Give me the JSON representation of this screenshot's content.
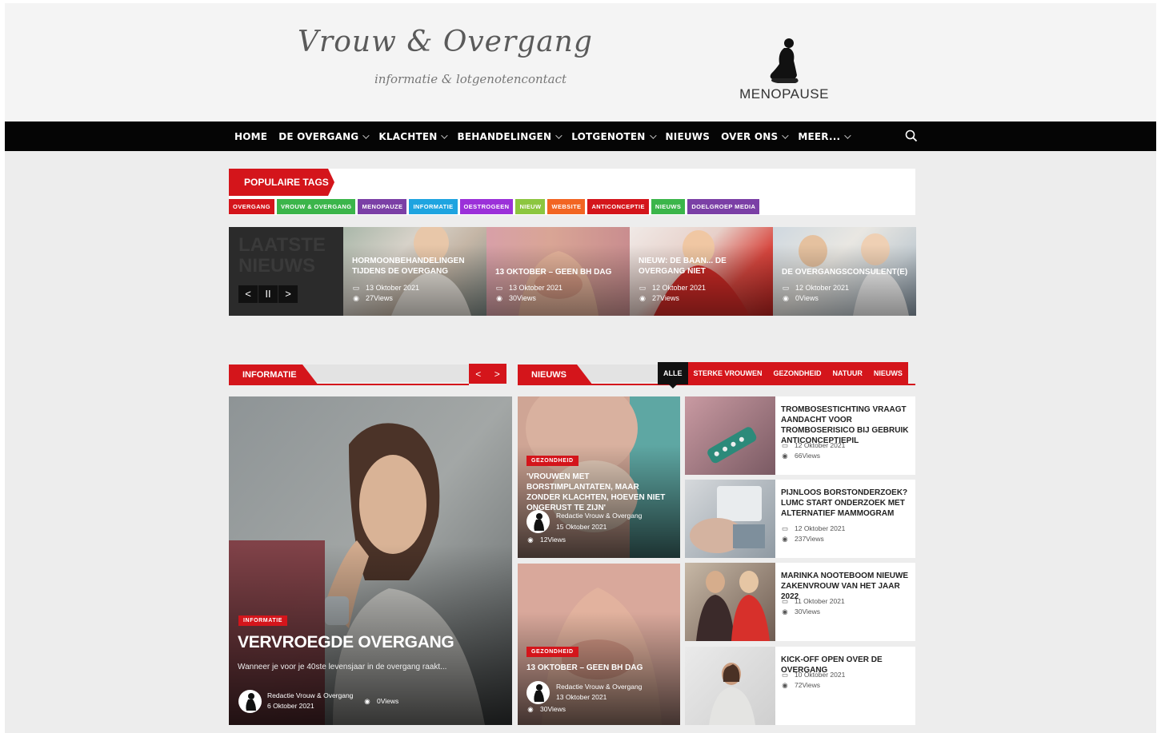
{
  "colors": {
    "accent": "#d4151b",
    "nav_bg": "#050505",
    "page_bg": "#ededed"
  },
  "header": {
    "site_title": "Vrouw & Overgang",
    "tagline": "informatie & lotgenotencontact",
    "partner_logo_text": "MENOPAUSE"
  },
  "nav": {
    "items": [
      {
        "label": "HOME",
        "dropdown": false
      },
      {
        "label": "DE OVERGANG",
        "dropdown": true
      },
      {
        "label": "KLACHTEN",
        "dropdown": true
      },
      {
        "label": "BEHANDELINGEN",
        "dropdown": true
      },
      {
        "label": "LOTGENOTEN",
        "dropdown": true
      },
      {
        "label": "NIEUWS",
        "dropdown": false
      },
      {
        "label": "OVER ONS",
        "dropdown": true
      },
      {
        "label": "MEER...",
        "dropdown": true
      }
    ],
    "search_icon": "search-icon"
  },
  "popular_tags": {
    "heading": "POPULAIRE TAGS",
    "tags": [
      {
        "label": "OVERGANG",
        "color": "#d4151b"
      },
      {
        "label": "VROUW & OVERGANG",
        "color": "#3bb54a"
      },
      {
        "label": "MENOPAUZE",
        "color": "#7b3fa6"
      },
      {
        "label": "INFORMATIE",
        "color": "#1ea4e0"
      },
      {
        "label": "OESTROGEEN",
        "color": "#9b30d9"
      },
      {
        "label": "NIEUW",
        "color": "#8cc63f"
      },
      {
        "label": "WEBSITE",
        "color": "#f26522"
      },
      {
        "label": "ANTICONCEPTIE",
        "color": "#d4151b"
      },
      {
        "label": "NIEUWS",
        "color": "#3bb54a"
      },
      {
        "label": "DOELGROEP MEDIA",
        "color": "#7b3fa6"
      }
    ]
  },
  "latest": {
    "label": "LAATSTE NIEUWS",
    "controls": {
      "prev": "<",
      "pause": "II",
      "next": ">"
    },
    "items": [
      {
        "title": "HORMOONBEHANDELINGEN TIJDENS DE OVERGANG",
        "date": "13 Oktober 2021",
        "views": "27Views"
      },
      {
        "title": "13 OKTOBER – GEEN BH DAG",
        "date": "13 Oktober 2021",
        "views": "30Views"
      },
      {
        "title": "NIEUW: DE BAAN... DE OVERGANG NIET",
        "date": "12 Oktober 2021",
        "views": "27Views"
      },
      {
        "title": "DE OVERGANGSCONSULENT(E)",
        "date": "12 Oktober 2021",
        "views": "0Views"
      }
    ]
  },
  "informatie": {
    "label": "INFORMATIE",
    "arrows": {
      "prev": "<",
      "next": ">"
    },
    "feature": {
      "badge": "INFORMATIE",
      "title": "VERVROEGDE OVERGANG",
      "excerpt": "Wanneer je voor je 40ste levensjaar in de overgang raakt...",
      "author": "Redactie Vrouw & Overgang",
      "date": "6 Oktober 2021",
      "views": "0Views"
    }
  },
  "nieuws": {
    "label": "NIEUWS",
    "filters": [
      "ALLE",
      "STERKE VROUWEN",
      "GEZONDHEID",
      "NATUUR",
      "NIEUWS"
    ],
    "cards": [
      {
        "badge": "GEZONDHEID",
        "title": "'VROUWEN MET BORSTIMPLANTATEN, MAAR ZONDER KLACHTEN, HOEVEN NIET ONGERUST TE ZIJN'",
        "author": "Redactie Vrouw & Overgang",
        "date": "15 Oktober 2021",
        "views": "12Views"
      },
      {
        "badge": "GEZONDHEID",
        "title": "13 OKTOBER – GEEN BH DAG",
        "author": "Redactie Vrouw & Overgang",
        "date": "13 Oktober 2021",
        "views": "30Views"
      }
    ],
    "list": [
      {
        "title": "TROMBOSESTICHTING VRAAGT AANDACHT VOOR TROMBOSERISICO BIJ GEBRUIK ANTICONCEPTIEPIL",
        "date": "12 Oktober 2021",
        "views": "66Views"
      },
      {
        "title": "PIJNLOOS BORSTONDERZOEK? LUMC START ONDERZOEK MET ALTERNATIEF MAMMOGRAM",
        "date": "12 Oktober 2021",
        "views": "237Views"
      },
      {
        "title": "MARINKA NOOTEBOOM NIEUWE ZAKENVROUW VAN HET JAAR 2022",
        "date": "11 Oktober 2021",
        "views": "30Views"
      },
      {
        "title": "KICK-OFF OPEN OVER DE OVERGANG",
        "date": "10 Oktober 2021",
        "views": "72Views"
      }
    ]
  }
}
